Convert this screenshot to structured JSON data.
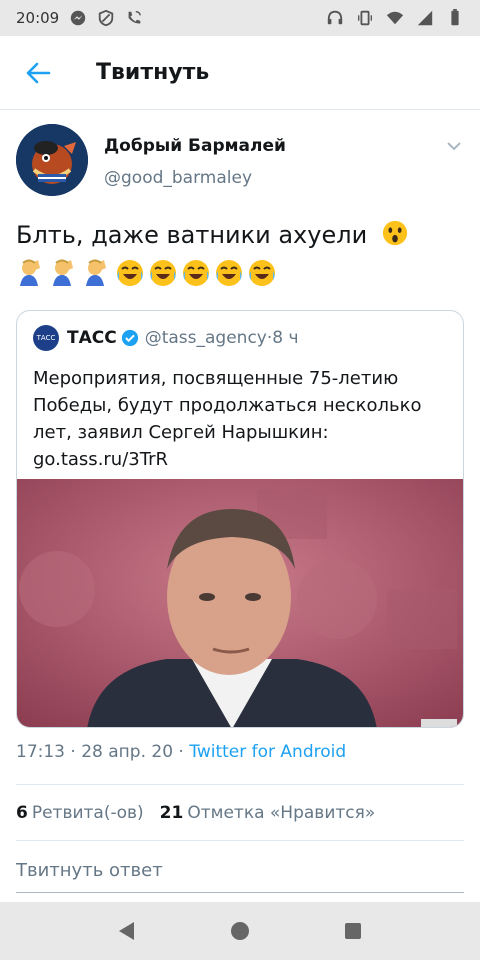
{
  "status_bar": {
    "time": "20:09"
  },
  "header": {
    "title": "Твитнуть"
  },
  "tweet": {
    "author_name": "Добрый Бармалей",
    "author_handle": "@good_barmaley",
    "text": "Блть, даже ватники ахуели",
    "emojis": [
      "astonished-face-emoji",
      "facepalm-emoji",
      "facepalm-emoji",
      "facepalm-emoji",
      "crying-laughing-emoji",
      "crying-laughing-emoji",
      "crying-laughing-emoji",
      "crying-laughing-emoji",
      "crying-laughing-emoji"
    ]
  },
  "quote": {
    "avatar_text": "ТАСС",
    "name": "ТАСС",
    "handle": "@tass_agency",
    "sep": " · ",
    "age": "8 ч",
    "text": "Мероприятия, посвященные 75-летию Победы, будут продолжаться несколько лет, заявил Сергей Нарышкин: go.tass.ru/3TrR"
  },
  "meta": {
    "time": "17:13",
    "dot1": " · ",
    "date": "28 апр. 20",
    "dot2": " · ",
    "source": "Twitter for Android"
  },
  "stats": {
    "retweets_count": "6",
    "retweets_label": "Ретвита(-ов)",
    "likes_count": "21",
    "likes_label": "Отметка «Нравится»"
  },
  "reply": {
    "placeholder": "Твитнуть ответ"
  },
  "colors": {
    "accent": "#1da1f2",
    "secondary_text": "#657786",
    "border": "#e1e8ed"
  }
}
